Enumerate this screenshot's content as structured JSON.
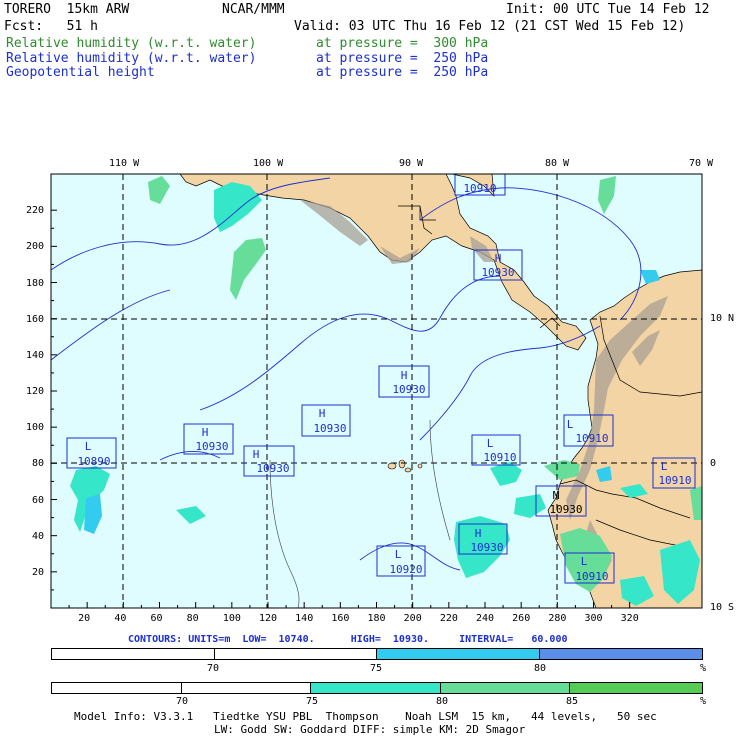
{
  "header": {
    "model": "TORERO  15km ARW",
    "org": "NCAR/MMM",
    "init": "Init: 00 UTC Tue 14 Feb 12",
    "fcst": "Fcst:   51 h",
    "valid": "Valid: 03 UTC Thu 16 Feb 12 (21 CST Wed 15 Feb 12)",
    "fields": [
      {
        "name": "Relative humidity (w.r.t. water)",
        "level": "at pressure =  300 hPa",
        "color": "#2e8b2e"
      },
      {
        "name": "Relative humidity (w.r.t. water)",
        "level": "at pressure =  250 hPa",
        "color": "#1c2fd0"
      },
      {
        "name": "Geopotential height",
        "level": "at pressure =  250 hPa",
        "color": "#1c2fd0"
      }
    ]
  },
  "map": {
    "lon_labels": [
      "110 W",
      "100 W",
      "90 W",
      "80 W",
      "70 W"
    ],
    "lat_labels": [
      "10 N",
      "0",
      "10 S"
    ],
    "x_ticks": [
      "20",
      "40",
      "60",
      "80",
      "100",
      "120",
      "140",
      "160",
      "180",
      "200",
      "220",
      "240",
      "260",
      "280",
      "300",
      "320"
    ],
    "y_ticks": [
      "20",
      "40",
      "60",
      "80",
      "100",
      "120",
      "140",
      "160",
      "180",
      "200",
      "220"
    ],
    "colors": {
      "ocean": "#dffcff",
      "land": "#f3d4a4",
      "terrain": "#a9a095"
    },
    "centers": [
      {
        "type": "H",
        "value": "10910"
      },
      {
        "type": "H",
        "value": "10930"
      },
      {
        "type": "H",
        "value": "10930"
      },
      {
        "type": "H",
        "value": "10930"
      },
      {
        "type": "H",
        "value": "10930"
      },
      {
        "type": "H",
        "value": "10930"
      },
      {
        "type": "L",
        "value": "10890"
      },
      {
        "type": "L",
        "value": "10910"
      },
      {
        "type": "L",
        "value": "10910"
      },
      {
        "type": "L",
        "value": "10910"
      },
      {
        "type": "L",
        "value": "10920"
      },
      {
        "type": "L",
        "value": "10910"
      },
      {
        "type": "H",
        "value": "10930"
      }
    ]
  },
  "contours_label": "CONTOURS: UNITS=m  LOW=  10740.      HIGH=  10930.     INTERVAL=   60.000",
  "legend_250": {
    "labels": [
      "70",
      "75",
      "80",
      "%"
    ],
    "colors": [
      "#ffffff",
      "#ffffff",
      "#33ccee",
      "#5a8ee8"
    ]
  },
  "legend_300": {
    "labels": [
      "70",
      "75",
      "80",
      "85",
      "%"
    ],
    "colors": [
      "#ffffff",
      "#ffffff",
      "#36e6c8",
      "#66dd99",
      "#55cc55"
    ]
  },
  "footer": {
    "line1": "Model Info: V3.3.1   Tiedtke YSU PBL  Thompson    Noah LSM  15 km,   44 levels,   50 sec",
    "line2": "LW: Godd SW: Goddard DIFF: simple KM: 2D Smagor"
  }
}
